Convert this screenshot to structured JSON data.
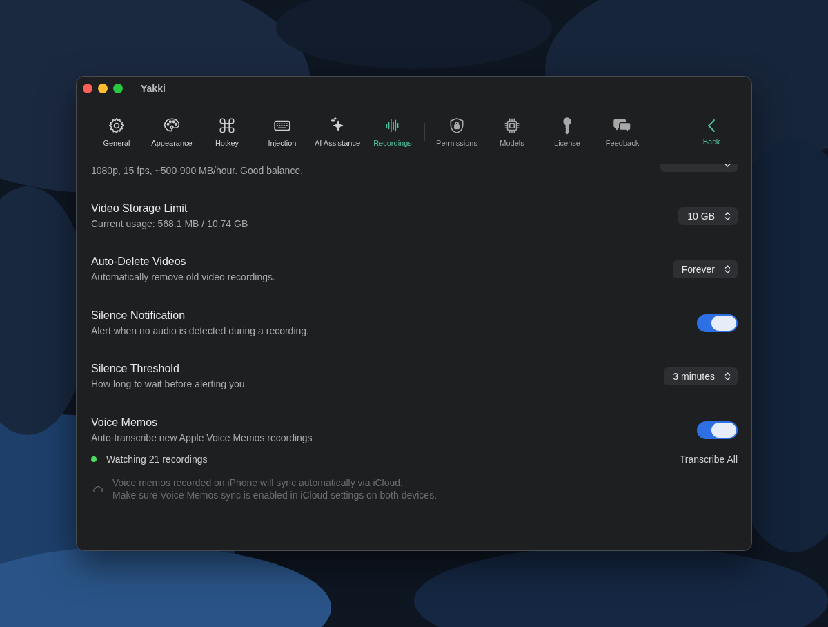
{
  "window": {
    "title": "Yakki"
  },
  "toolbar": {
    "primary_tabs": [
      {
        "label": "General",
        "selected": false
      },
      {
        "label": "Appearance",
        "selected": false
      },
      {
        "label": "Hotkey",
        "selected": false
      },
      {
        "label": "Injection",
        "selected": false
      },
      {
        "label": "AI Assistance",
        "selected": false
      },
      {
        "label": "Recordings",
        "selected": true
      }
    ],
    "secondary_tabs": [
      {
        "label": "Permissions",
        "selected": false
      },
      {
        "label": "Models",
        "selected": false
      },
      {
        "label": "License",
        "selected": false
      },
      {
        "label": "Feedback",
        "selected": false
      }
    ],
    "back_button": "Back"
  },
  "sections": [
    {
      "rows": [
        {
          "subtitle": "1080p, 15 fps, ~500-900 MB/hour. Good balance.",
          "control": {
            "kind": "popup"
          }
        },
        {
          "title": "Video Storage Limit",
          "subtitle": "Current usage: 568.1 MB / 10.74 GB",
          "control": {
            "kind": "popup",
            "value": "10 GB"
          }
        },
        {
          "title": "Auto-Delete Videos",
          "subtitle": "Automatically remove old video recordings.",
          "control": {
            "kind": "popup",
            "value": "Forever"
          }
        }
      ]
    },
    {
      "rows": [
        {
          "title": "Silence Notification",
          "subtitle": "Alert when no audio is detected during a recording.",
          "control": {
            "kind": "toggle",
            "on": true
          }
        },
        {
          "title": "Silence Threshold",
          "subtitle": "How long to wait before alerting you.",
          "control": {
            "kind": "popup",
            "value": "3 minutes"
          }
        }
      ]
    },
    {
      "rows": [
        {
          "title": "Voice Memos",
          "subtitle": "Auto-transcribe new Apple Voice Memos recordings",
          "control": {
            "kind": "toggle",
            "on": true
          }
        }
      ],
      "status": {
        "text": "Watching 21 recordings",
        "color": "#4cd964"
      },
      "action_button": "Transcribe All",
      "note_lines": [
        "Voice memos recorded on iPhone will sync automatically via iCloud.",
        "Make sure Voice Memos sync is enabled in iCloud settings on both devices."
      ]
    }
  ]
}
